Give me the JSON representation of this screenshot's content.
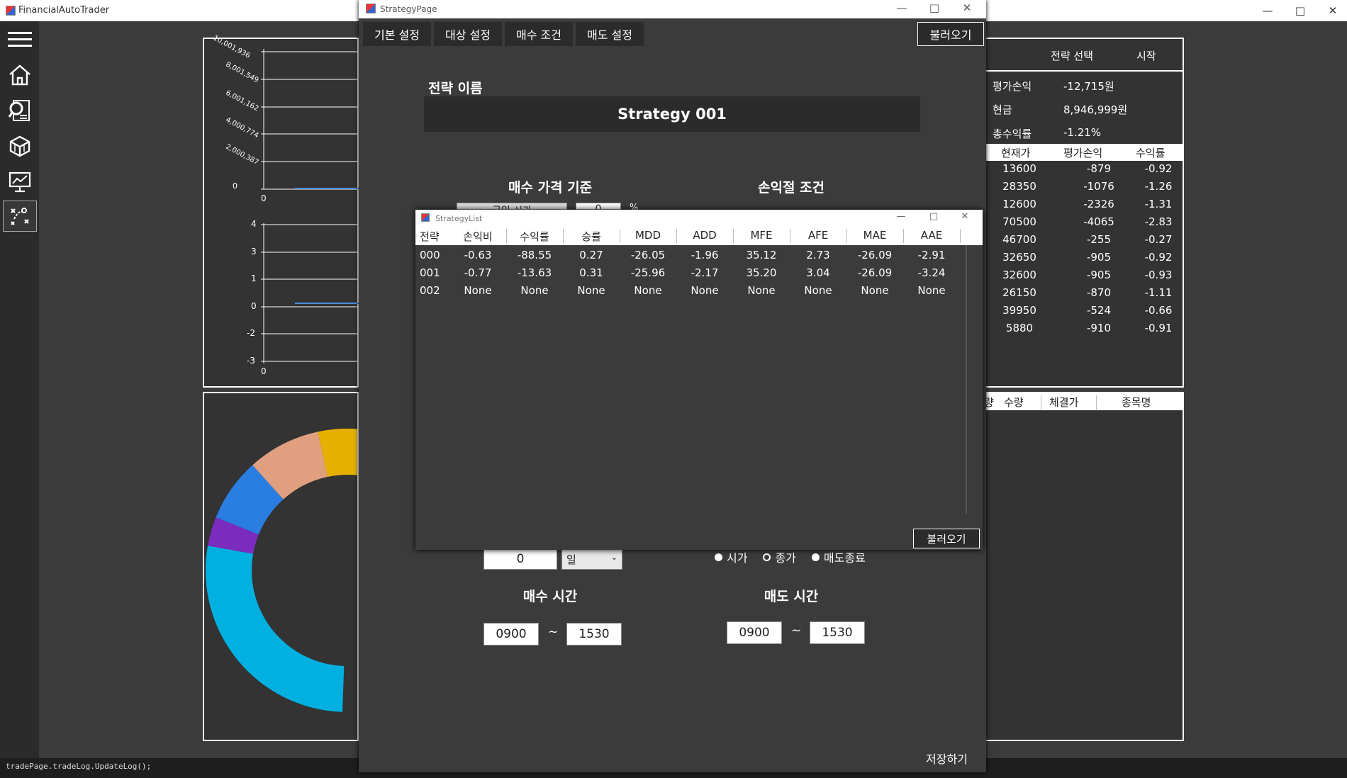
{
  "main_window": {
    "title": "FinancialAutoTrader"
  },
  "chart_top": {
    "y_ticks": [
      "0",
      "2,000,387",
      "4,000,774",
      "6,001,162",
      "8,001,549",
      "10,001,936"
    ],
    "x_tick": "0"
  },
  "chart_mid": {
    "y_ticks": [
      "4",
      "3",
      "1",
      "0",
      "-2",
      "-3"
    ],
    "x_tick": "0"
  },
  "right_panel": {
    "strategy_select": "전략 선택",
    "start": "시작",
    "summary": [
      {
        "label": "평가손익",
        "value": "-12,715원"
      },
      {
        "label": "현금",
        "value": "8,946,999원"
      },
      {
        "label": "총수익률",
        "value": "-1.21%"
      }
    ],
    "headers": [
      "현재가",
      "평가손익",
      "수익률"
    ],
    "rows": [
      [
        "13600",
        "-879",
        "-0.92"
      ],
      [
        "28350",
        "-1076",
        "-1.26"
      ],
      [
        "12600",
        "-2326",
        "-1.31"
      ],
      [
        "70500",
        "-4065",
        "-2.83"
      ],
      [
        "46700",
        "-255",
        "-0.27"
      ],
      [
        "32650",
        "-905",
        "-0.92"
      ],
      [
        "32600",
        "-905",
        "-0.93"
      ],
      [
        "26150",
        "-870",
        "-1.11"
      ],
      [
        "39950",
        "-524",
        "-0.66"
      ],
      [
        "5880",
        "-910",
        "-0.91"
      ]
    ],
    "log_headers": [
      "량",
      "수량",
      "체결가",
      "종목명"
    ]
  },
  "code_line": "tradePage.tradeLog.UpdateLog();",
  "strategy_page": {
    "title": "StrategyPage",
    "tabs": [
      "기본 설정",
      "대상 설정",
      "매수 조건",
      "매도 설정"
    ],
    "load_button": "불러오기",
    "name_label": "전략 이름",
    "name_value": "Strategy 001",
    "buy_price_label": "매수 가격 기준",
    "buy_price_select": "금일 시가",
    "buy_price_value": "0",
    "buy_price_unit": "%",
    "stop_label": "손익절 조건",
    "period_value": "0",
    "period_unit": "일",
    "radio_options": [
      "시가",
      "종가",
      "매도종료"
    ],
    "buy_time_label": "매수 시간",
    "buy_time_from": "0900",
    "buy_time_to": "1530",
    "sell_time_label": "매도 시간",
    "sell_time_from": "0900",
    "sell_time_to": "1530",
    "tilde": "~",
    "save_button": "저장하기"
  },
  "strategy_list": {
    "title": "StrategyList",
    "headers": [
      "전략",
      "손익비",
      "수익률",
      "승률",
      "MDD",
      "ADD",
      "MFE",
      "AFE",
      "MAE",
      "AAE"
    ],
    "rows": [
      [
        "000",
        "-0.63",
        "-88.55",
        "0.27",
        "-26.05",
        "-1.96",
        "35.12",
        "2.73",
        "-26.09",
        "-2.91"
      ],
      [
        "001",
        "-0.77",
        "-13.63",
        "0.31",
        "-25.96",
        "-2.17",
        "35.20",
        "3.04",
        "-26.09",
        "-3.24"
      ],
      [
        "002",
        "None",
        "None",
        "None",
        "None",
        "None",
        "None",
        "None",
        "None",
        "None"
      ]
    ],
    "load_button": "불러오기"
  },
  "colors": {
    "donut": [
      "#00b0e0",
      "#7b2cbf",
      "#2a7de1",
      "#e0a080",
      "#e6b000",
      "#2ecfb0",
      "#1db954"
    ]
  }
}
